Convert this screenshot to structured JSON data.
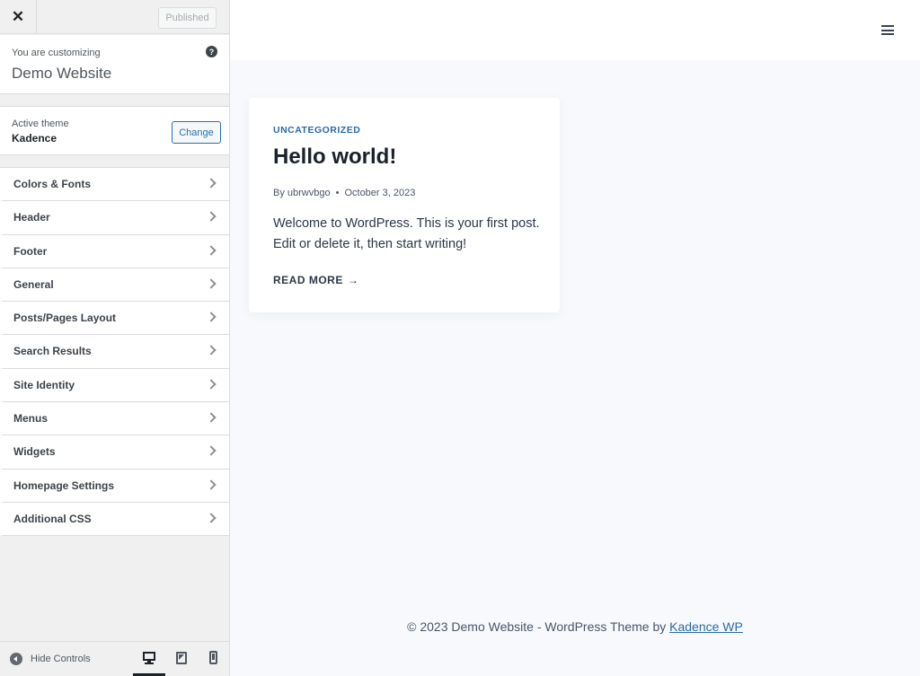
{
  "topbar": {
    "close_glyph": "✕",
    "publish_label": "Published"
  },
  "info": {
    "customizing_label": "You are customizing",
    "site_name": "Demo Website",
    "help_glyph": "?"
  },
  "theme": {
    "label": "Active theme",
    "name": "Kadence",
    "change_label": "Change"
  },
  "menu": {
    "items": [
      {
        "label": "Colors & Fonts"
      },
      {
        "label": "Header"
      },
      {
        "label": "Footer"
      },
      {
        "label": "General"
      },
      {
        "label": "Posts/Pages Layout"
      },
      {
        "label": "Search Results"
      },
      {
        "label": "Site Identity"
      },
      {
        "label": "Menus"
      },
      {
        "label": "Widgets"
      },
      {
        "label": "Homepage Settings"
      },
      {
        "label": "Additional CSS"
      }
    ]
  },
  "footer_bar": {
    "hide_controls_label": "Hide Controls",
    "devices": [
      "desktop",
      "tablet",
      "mobile"
    ],
    "active_device": "desktop"
  },
  "preview": {
    "post": {
      "category": "UNCATEGORIZED",
      "title": "Hello world!",
      "author": "By ubrwvbgo",
      "separator": "•",
      "date": "October 3, 2023",
      "excerpt": "Welcome to WordPress. This is your first post. Edit or delete it, then start writing!",
      "read_more": "READ MORE",
      "read_more_arrow": "→"
    },
    "footer": {
      "text": "© 2023 Demo Website - WordPress Theme by",
      "link_text": "Kadence WP"
    }
  },
  "colors": {
    "accent": "#2271b1",
    "post_category": "#2c6aa6",
    "preview_bg": "#f7f9fc"
  }
}
